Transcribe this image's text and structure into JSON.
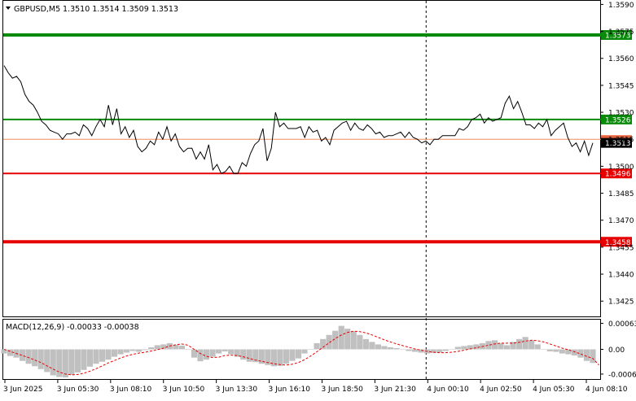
{
  "header": {
    "symbol": "GBPUSD,M5",
    "ohlc": "1.3510 1.3514 1.3509 1.3513",
    "indicator": "MACD(12,26,9) -0.00033 -0.00038"
  },
  "colors": {
    "background": "#ffffff",
    "price_line": "#000000",
    "green_level": "#0a8a0a",
    "red_level": "#e60000",
    "bid_line": "#f08c5a",
    "macd_hist": "#c0c0c0",
    "signal_line": "#e60000"
  },
  "chart_data": [
    {
      "type": "line",
      "title": "GBPUSD,M5",
      "ylim": [
        1.34165,
        1.3592
      ],
      "y_ticks": [
        "1.3590",
        "1.3575",
        "1.3560",
        "1.3545",
        "1.3530",
        "1.3515",
        "1.3500",
        "1.3485",
        "1.3470",
        "1.3455",
        "1.3440",
        "1.3425"
      ],
      "x_ticks": [
        "3 Jun 2025",
        "3 Jun 05:30",
        "3 Jun 08:10",
        "3 Jun 10:50",
        "3 Jun 13:30",
        "3 Jun 16:10",
        "3 Jun 18:50",
        "3 Jun 21:30",
        "4 Jun 00:10",
        "4 Jun 02:50",
        "4 Jun 05:30",
        "4 Jun 08:10"
      ],
      "day_separator": "4 Jun 00:10",
      "levels": [
        {
          "value": 1.3573,
          "label": "1.3573",
          "color": "green",
          "weight": "thick"
        },
        {
          "value": 1.3526,
          "label": "1.3526",
          "color": "green",
          "weight": "normal"
        },
        {
          "value": 1.3496,
          "label": "1.3496",
          "color": "red",
          "weight": "normal"
        },
        {
          "value": 1.3458,
          "label": "1.3458",
          "color": "red",
          "weight": "thick"
        }
      ],
      "current_price": {
        "value": 1.3513,
        "label": "1.3513"
      },
      "bid_line": 1.3515,
      "series": [
        {
          "values": [
            1.3556,
            1.3552,
            1.3549,
            1.355,
            1.3547,
            1.354,
            1.3536,
            1.3534,
            1.353,
            1.3525,
            1.3523,
            1.352,
            1.3519,
            1.3518,
            1.3515,
            1.3518,
            1.3518,
            1.3519,
            1.3517,
            1.3523,
            1.3521,
            1.3517,
            1.3522,
            1.3526,
            1.3522,
            1.3534,
            1.3523,
            1.3532,
            1.3518,
            1.3522,
            1.3516,
            1.352,
            1.3511,
            1.3508,
            1.351,
            1.3514,
            1.3512,
            1.3519,
            1.3515,
            1.3522,
            1.3514,
            1.3518,
            1.3511,
            1.3508,
            1.351,
            1.351,
            1.3504,
            1.3508,
            1.3504,
            1.3512,
            1.3498,
            1.3501,
            1.3496,
            1.3497,
            1.35,
            1.3496,
            1.3496,
            1.3502,
            1.35,
            1.3507,
            1.3512,
            1.3514,
            1.3521,
            1.3503,
            1.351,
            1.353,
            1.3522,
            1.3524,
            1.3521,
            1.3521,
            1.3521,
            1.3522,
            1.3516,
            1.3522,
            1.3519,
            1.352,
            1.3514,
            1.3516,
            1.3512,
            1.352,
            1.3522,
            1.3524,
            1.3525,
            1.352,
            1.3524,
            1.3521,
            1.352,
            1.3523,
            1.3521,
            1.3518,
            1.3519,
            1.3516,
            1.3517,
            1.3517,
            1.3518,
            1.3519,
            1.3516,
            1.3519,
            1.3516,
            1.3515,
            1.3513,
            1.3514,
            1.3512,
            1.3515,
            1.3515,
            1.3517,
            1.3517,
            1.3517,
            1.3517,
            1.3521,
            1.352,
            1.3522,
            1.3526,
            1.3527,
            1.3529,
            1.3524,
            1.3527,
            1.3525,
            1.3526,
            1.3527,
            1.3535,
            1.3539,
            1.3532,
            1.3536,
            1.353,
            1.3523,
            1.3523,
            1.3521,
            1.3524,
            1.3522,
            1.3526,
            1.3517,
            1.352,
            1.3522,
            1.3524,
            1.3516,
            1.3511,
            1.3513,
            1.3508,
            1.3514,
            1.3506,
            1.3513
          ]
        }
      ]
    },
    {
      "type": "bar",
      "title": "MACD(12,26,9) -0.00033 -0.00038",
      "ylim": [
        -0.00072,
        0.00072
      ],
      "y_ticks": [
        "0.00063",
        "0.00",
        "-0.0006"
      ],
      "series": [
        {
          "name": "MACD",
          "values": [
            -0.0001,
            -0.00016,
            -0.0002,
            -0.00028,
            -0.00035,
            -0.00041,
            -0.00048,
            -0.00055,
            -0.00063,
            -0.00067,
            -0.00068,
            -0.00062,
            -0.00056,
            -0.0005,
            -0.00042,
            -0.00035,
            -0.0003,
            -0.00025,
            -0.00018,
            -0.00012,
            -8e-05,
            -4e-05,
            -6e-05,
            -2e-05,
            5e-05,
            0.0001,
            0.00012,
            0.00015,
            0.00011,
            9e-05,
            0.0,
            -0.0002,
            -0.00029,
            -0.00025,
            -0.00018,
            -0.0001,
            -5e-05,
            -0.00012,
            -0.00018,
            -0.00025,
            -0.0003,
            -0.00031,
            -0.00035,
            -0.00038,
            -0.00041,
            -0.0004,
            -0.00035,
            -0.00028,
            -0.00022,
            -0.0001,
            0.0,
            0.00015,
            0.00025,
            0.00035,
            0.00045,
            0.00057,
            0.0005,
            0.00044,
            0.00035,
            0.00025,
            0.00018,
            0.00012,
            8e-05,
            5e-05,
            3e-05,
            0.0,
            -4e-05,
            -6e-05,
            -8e-05,
            -0.0001,
            -9e-05,
            -8e-05,
            -4e-05,
            0.0,
            6e-05,
            8e-05,
            0.0001,
            0.00012,
            0.00015,
            0.0002,
            0.00022,
            0.00015,
            0.0001,
            0.00018,
            0.00025,
            0.0003,
            0.00022,
            0.00012,
            0.0,
            -5e-05,
            -6e-05,
            -0.0001,
            -0.00012,
            -0.00015,
            -0.0002,
            -0.00028,
            -0.00033
          ]
        },
        {
          "name": "Signal",
          "values": [
            0.0,
            -5e-05,
            -0.0001,
            -0.00015,
            -0.0002,
            -0.00026,
            -0.00032,
            -0.0004,
            -0.00048,
            -0.00055,
            -0.0006,
            -0.00062,
            -0.00061,
            -0.00058,
            -0.00053,
            -0.00047,
            -0.0004,
            -0.00033,
            -0.00027,
            -0.00021,
            -0.00016,
            -0.00012,
            -9e-05,
            -7e-05,
            -4e-05,
            -1e-05,
            3e-05,
            8e-05,
            0.00011,
            0.00013,
            0.0001,
            0.0,
            -0.0001,
            -0.00017,
            -0.0002,
            -0.00019,
            -0.00015,
            -0.00014,
            -0.00015,
            -0.00018,
            -0.00022,
            -0.00026,
            -0.00029,
            -0.00032,
            -0.00035,
            -0.00037,
            -0.00038,
            -0.00036,
            -0.00032,
            -0.00025,
            -0.00016,
            -6e-05,
            5e-05,
            0.00016,
            0.00026,
            0.00035,
            0.00041,
            0.00044,
            0.00043,
            0.0004,
            0.00035,
            0.00029,
            0.00023,
            0.00018,
            0.00013,
            9e-05,
            5e-05,
            1e-05,
            -2e-05,
            -5e-05,
            -7e-05,
            -8e-05,
            -8e-05,
            -7e-05,
            -5e-05,
            -2e-05,
            1e-05,
            4e-05,
            7e-05,
            0.0001,
            0.00013,
            0.00015,
            0.00015,
            0.00015,
            0.00017,
            0.0002,
            0.00022,
            0.00021,
            0.00018,
            0.00013,
            8e-05,
            3e-05,
            -1e-05,
            -6e-05,
            -0.00011,
            -0.00017,
            -0.00022,
            -0.00038
          ]
        }
      ]
    }
  ]
}
